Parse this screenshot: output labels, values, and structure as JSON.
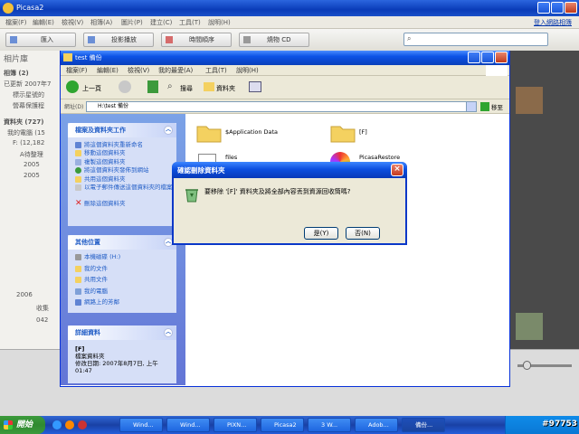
{
  "picasa": {
    "title": "Picasa2",
    "menu": [
      "檔案(F)",
      "編輯(E)",
      "檢視(V)",
      "相簿(A)",
      "圖片(P)",
      "建立(C)",
      "工具(T)",
      "說明(H)"
    ],
    "signin": "登入網路相簿",
    "toolbar": {
      "import": "匯入",
      "slideshow": "投影播放",
      "timeline": "時間順序",
      "cd": "燒物 CD"
    },
    "library_title": "相片庫",
    "library": {
      "albums": "相簿 (2)",
      "updated": "已更新 2007年7",
      "item1": "標示星號的",
      "item2": "營幕保護程",
      "folders": "資料夾 (727)",
      "mycomputer": "我的電腦 (15",
      "drive_f": "F: (12,182",
      "a_folder": "A待整理",
      "y2005a": "2005",
      "y2005b": "2005",
      "y2006": "2006",
      "collect": "收集",
      "n042": "042"
    }
  },
  "explorer": {
    "title": "test 備份",
    "menu": [
      "檔案(F)",
      "編輯(E)",
      "檢視(V)",
      "我的最愛(A)",
      "工具(T)",
      "說明(H)"
    ],
    "back": "上一頁",
    "search": "搜尋",
    "folders": "資料夾",
    "address_label": "網址(D)",
    "address": "H:\\test 備份",
    "go": "移至",
    "tasks_title": "檔案及資料夾工作",
    "tasks": [
      "將這個資料夾重新命名",
      "移動這個資料夾",
      "複製這個資料夾",
      "將這個資料夾發佈到網站",
      "共用這個資料夾",
      "以電子郵件傳送這個資料夾的檔案",
      "刪除這個資料夾"
    ],
    "other_title": "其他位置",
    "other": [
      "本機磁碟 (H:)",
      "我的文件",
      "共用文件",
      "我的電腦",
      "網路上的芳鄰"
    ],
    "details_title": "詳細資料",
    "details_name": "[F]",
    "details_type": "檔案資料夾",
    "details_date": "修改日期: 2007年8月7日, 上午 01:47",
    "files": {
      "f1": "$Application Data",
      "f2": "[F]",
      "f3": "files",
      "f4": "PicasaRestore"
    }
  },
  "dialog": {
    "title": "確認刪除資料夾",
    "message": "要移除 '[F]' 資料夾及將全部內容丟到資源回收筒嗎?",
    "yes": "是(Y)",
    "no": "否(N)"
  },
  "taskbar": {
    "start": "開始",
    "items": [
      "Wind...",
      "Wind...",
      "PIXN...",
      "Picasa2",
      "3 W...",
      "Adob...",
      "備份..."
    ],
    "watermark": "#97753"
  },
  "colors": {
    "xp_blue": "#0a3cb8",
    "panel_bg": "#d6dff7",
    "start_green": "#3c9a3c"
  }
}
